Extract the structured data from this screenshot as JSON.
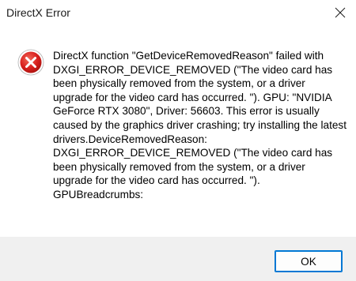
{
  "window": {
    "title": "DirectX Error",
    "close_icon": "close-icon"
  },
  "dialog": {
    "icon": "error-icon",
    "message": "DirectX function \"GetDeviceRemovedReason\" failed with DXGI_ERROR_DEVICE_REMOVED (\"The video card has been physically removed from the system, or a driver upgrade for the video card has occurred. \"). GPU: \"NVIDIA GeForce RTX 3080\", Driver: 56603. This error is usually caused by the graphics driver crashing; try installing the latest drivers.DeviceRemovedReason:\nDXGI_ERROR_DEVICE_REMOVED (\"The video card has been physically removed from the system, or a driver upgrade for the video card has occurred. \").\nGPUBreadcrumbs:"
  },
  "footer": {
    "ok_label": "OK"
  },
  "colors": {
    "accent": "#0078d4",
    "error_red": "#d9201e",
    "footer_bg": "#f0f0f0"
  }
}
